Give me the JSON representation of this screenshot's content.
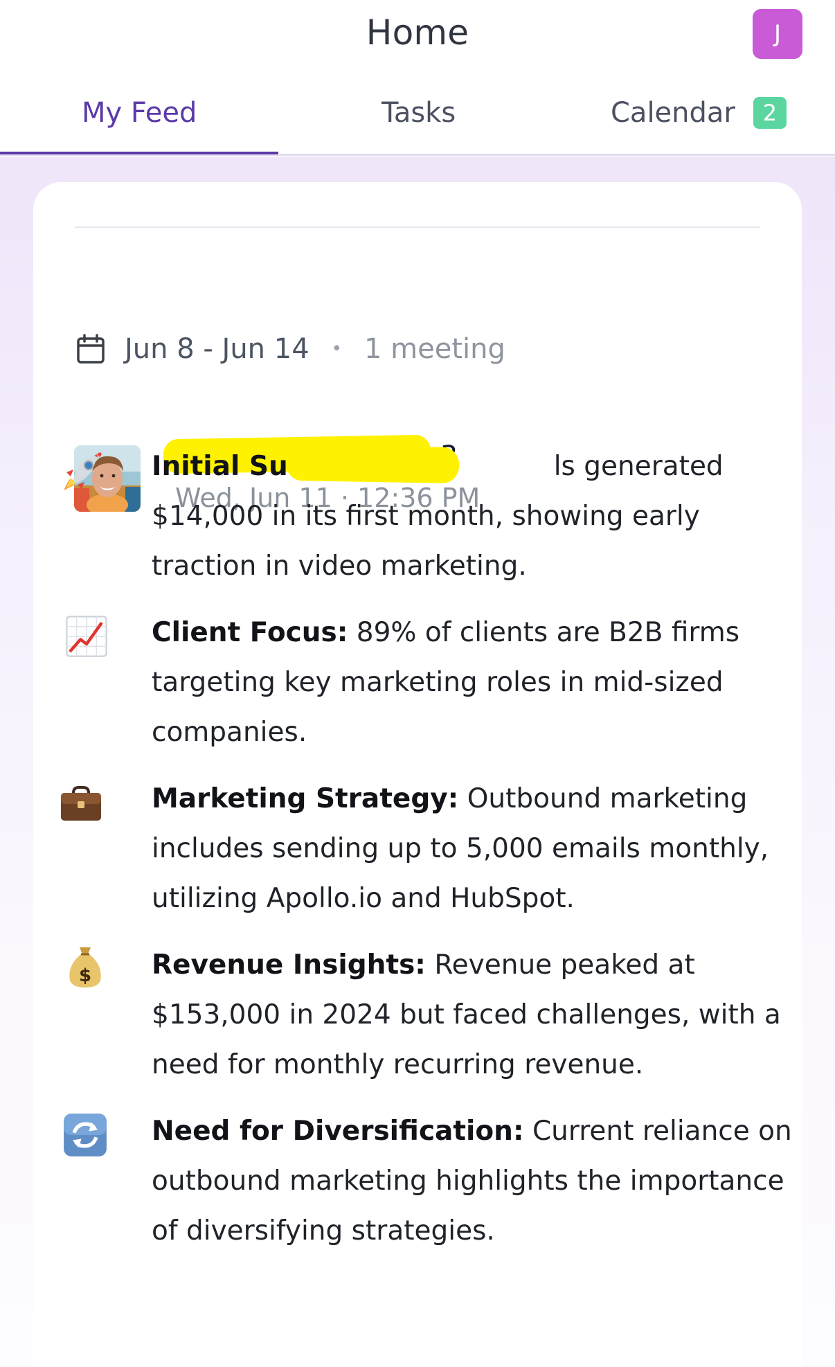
{
  "header": {
    "title": "Home",
    "avatar_initial": "J",
    "avatar_color": "#c95bd6"
  },
  "tabs": [
    {
      "label": "My Feed",
      "active": true
    },
    {
      "label": "Tasks",
      "active": false
    },
    {
      "label": "Calendar",
      "active": false,
      "badge": "2"
    }
  ],
  "colors": {
    "accent": "#5a3aa8",
    "badge": "#5bd6a0",
    "redaction": "#fff200"
  },
  "feed": {
    "week": {
      "icon": "calendar-icon",
      "range": "Jun 8 - Jun 14",
      "separator": "•",
      "count": "1 meeting"
    },
    "recording": {
      "title_visible_suffix": "_Au.mp3",
      "datetime": "Wed, Jun 11 · 12:36 PM",
      "avatar": "participant-avatar"
    },
    "bullets": [
      {
        "icon": "rocket-icon",
        "heading": "Initial Success.",
        "text": "ls generated $14,000 in its first month, showing early traction in video marketing."
      },
      {
        "icon": "chart-increasing-icon",
        "heading": "Client Focus:",
        "text": "89% of clients are B2B firms targeting key marketing roles in mid-sized companies."
      },
      {
        "icon": "briefcase-icon",
        "heading": "Marketing Strategy:",
        "text": "Outbound marketing includes sending up to 5,000 emails monthly, utilizing Apollo.io and HubSpot."
      },
      {
        "icon": "money-bag-icon",
        "heading": "Revenue Insights:",
        "text": "Revenue peaked at $153,000 in 2024 but faced challenges, with a need for monthly recurring revenue."
      },
      {
        "icon": "refresh-icon",
        "heading": "Need for Diversification:",
        "text": "Current reliance on outbound marketing highlights the importance of diversifying strategies."
      }
    ]
  }
}
